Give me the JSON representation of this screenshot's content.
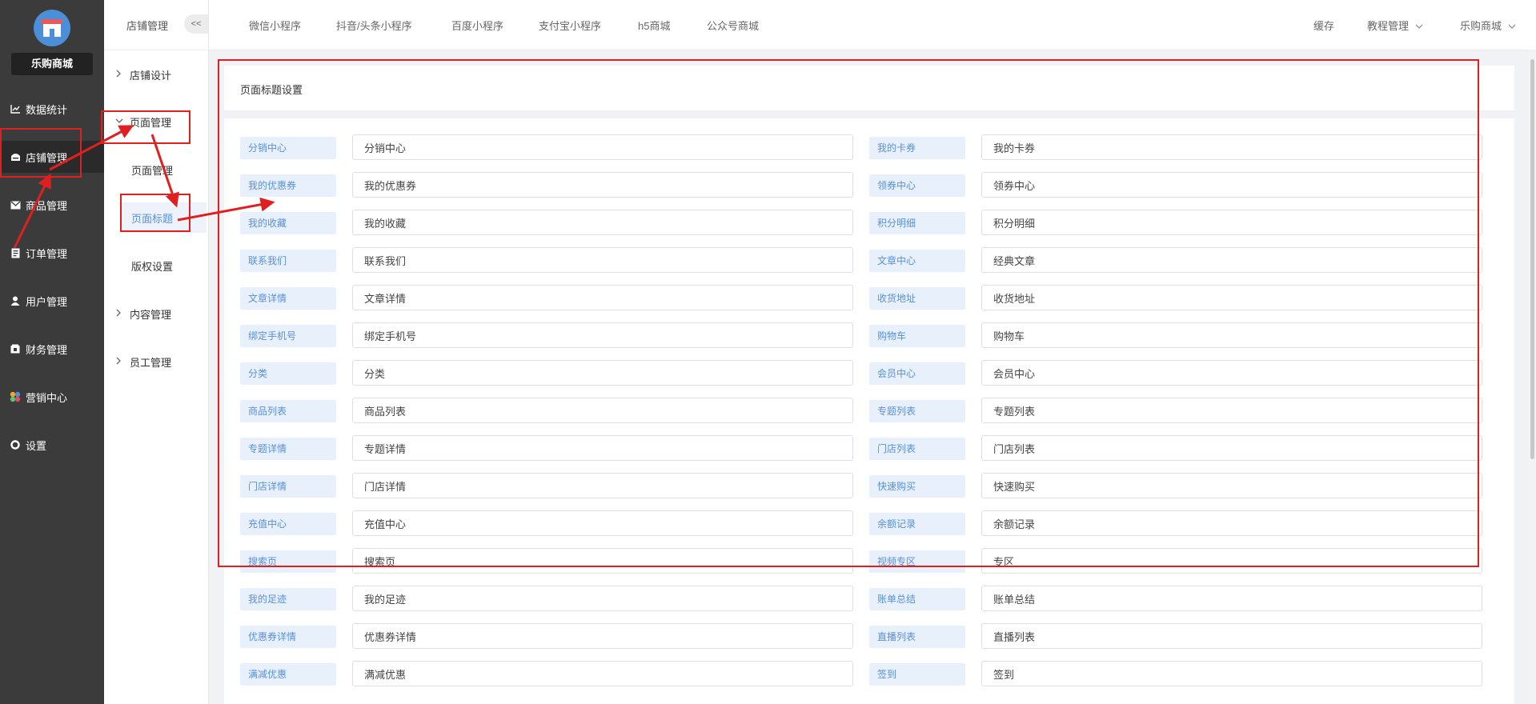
{
  "sidebar": {
    "brand": "乐购商城",
    "items": [
      {
        "label": "数据统计",
        "icon": "line-chart-icon"
      },
      {
        "label": "店铺管理",
        "icon": "store-icon"
      },
      {
        "label": "商品管理",
        "icon": "mail-icon"
      },
      {
        "label": "订单管理",
        "icon": "order-icon"
      },
      {
        "label": "用户管理",
        "icon": "user-icon"
      },
      {
        "label": "财务管理",
        "icon": "finance-icon"
      },
      {
        "label": "营销中心",
        "icon": "marketing-icon"
      },
      {
        "label": "设置",
        "icon": "gear-icon"
      }
    ]
  },
  "subnav": {
    "title": "店铺管理",
    "collapse": "<<",
    "groups": [
      {
        "label": "店铺设计",
        "icon": "chevron-right-icon"
      },
      {
        "label": "页面管理",
        "icon": "chevron-down-icon"
      },
      {
        "label": "内容管理",
        "icon": "chevron-right-icon"
      },
      {
        "label": "员工管理",
        "icon": "chevron-right-icon"
      }
    ],
    "children": [
      "页面管理",
      "页面标题",
      "版权设置"
    ]
  },
  "topbar": {
    "tabs": [
      "微信小程序",
      "抖音/头条小程序",
      "百度小程序",
      "支付宝小程序",
      "h5商城",
      "公众号商城"
    ],
    "right": [
      "缓存",
      "教程管理",
      "乐购商城"
    ]
  },
  "page": {
    "title": "页面标题设置"
  },
  "rows": [
    {
      "left": {
        "label": "分销中心",
        "value": "分销中心"
      },
      "right": {
        "label": "我的卡券",
        "value": "我的卡券"
      }
    },
    {
      "left": {
        "label": "我的优惠券",
        "value": "我的优惠券"
      },
      "right": {
        "label": "领券中心",
        "value": "领券中心"
      }
    },
    {
      "left": {
        "label": "我的收藏",
        "value": "我的收藏"
      },
      "right": {
        "label": "积分明细",
        "value": "积分明细"
      }
    },
    {
      "left": {
        "label": "联系我们",
        "value": "联系我们"
      },
      "right": {
        "label": "文章中心",
        "value": "经典文章"
      }
    },
    {
      "left": {
        "label": "文章详情",
        "value": "文章详情"
      },
      "right": {
        "label": "收货地址",
        "value": "收货地址"
      }
    },
    {
      "left": {
        "label": "绑定手机号",
        "value": "绑定手机号"
      },
      "right": {
        "label": "购物车",
        "value": "购物车"
      }
    },
    {
      "left": {
        "label": "分类",
        "value": "分类"
      },
      "right": {
        "label": "会员中心",
        "value": "会员中心"
      }
    },
    {
      "left": {
        "label": "商品列表",
        "value": "商品列表"
      },
      "right": {
        "label": "专题列表",
        "value": "专题列表"
      }
    },
    {
      "left": {
        "label": "专题详情",
        "value": "专题详情"
      },
      "right": {
        "label": "门店列表",
        "value": "门店列表"
      }
    },
    {
      "left": {
        "label": "门店详情",
        "value": "门店详情"
      },
      "right": {
        "label": "快速购买",
        "value": "快速购买"
      }
    },
    {
      "left": {
        "label": "充值中心",
        "value": "充值中心"
      },
      "right": {
        "label": "余额记录",
        "value": "余额记录"
      }
    },
    {
      "left": {
        "label": "搜索页",
        "value": "搜索页"
      },
      "right": {
        "label": "视频专区",
        "value": "专区"
      }
    },
    {
      "left": {
        "label": "我的足迹",
        "value": "我的足迹"
      },
      "right": {
        "label": "账单总结",
        "value": "账单总结"
      }
    },
    {
      "left": {
        "label": "优惠券详情",
        "value": "优惠券详情"
      },
      "right": {
        "label": "直播列表",
        "value": "直播列表"
      }
    },
    {
      "left": {
        "label": "满减优惠",
        "value": "满减优惠"
      },
      "right": {
        "label": "签到",
        "value": "签到"
      }
    }
  ],
  "colors": {
    "sidebar_bg": "#3b3b3b",
    "label_bg": "#e8f1fb",
    "label_text": "#5a8fd6",
    "annotation": "#e02020"
  }
}
